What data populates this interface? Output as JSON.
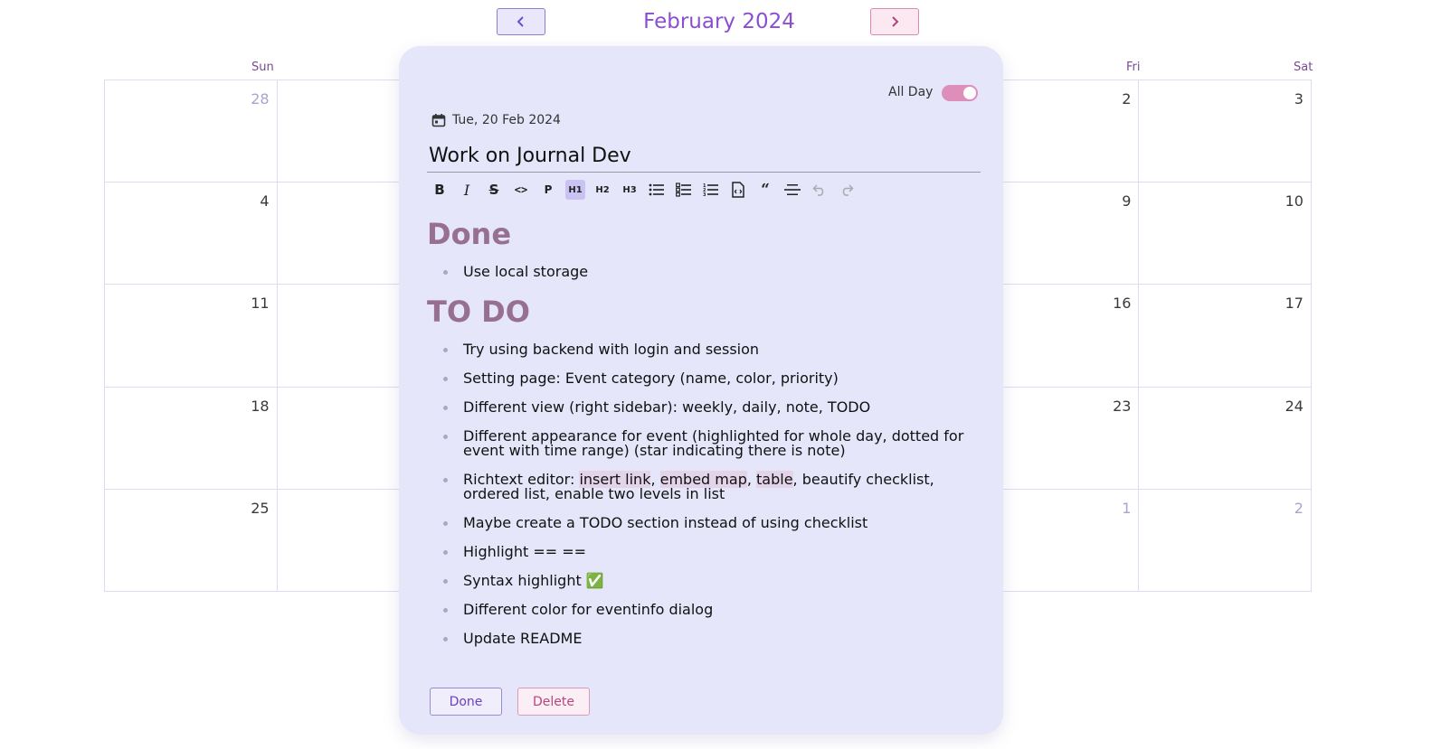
{
  "header": {
    "month_title": "February 2024",
    "prev_icon": "chevron-left-icon",
    "next_icon": "chevron-right-icon"
  },
  "weekdays": [
    "Sun",
    "Fri",
    "Sat"
  ],
  "calendar": {
    "rows": [
      {
        "sun": "28",
        "fri": "2",
        "sat": "3",
        "sun_other": true
      },
      {
        "sun": "4",
        "fri": "9",
        "sat": "10"
      },
      {
        "sun": "11",
        "fri": "16",
        "sat": "17"
      },
      {
        "sun": "18",
        "fri": "23",
        "sat": "24"
      },
      {
        "sun": "25",
        "fri": "1",
        "sat": "2",
        "next_other": true
      }
    ]
  },
  "dialog": {
    "all_day_label": "All Day",
    "all_day_on": true,
    "date": "Tue, 20 Feb 2024",
    "title_value": "Work on Journal Dev",
    "toolbar": [
      "B",
      "I",
      "S",
      "<>",
      "P",
      "H1",
      "H2",
      "H3",
      "bullet-list",
      "checklist",
      "ordered-list",
      "code-block",
      "quote",
      "horizontal-rule",
      "undo",
      "redo"
    ],
    "active_tool": "H1",
    "heading_done": "Done",
    "done_items": [
      "Use local storage"
    ],
    "heading_todo": "TO DO",
    "todo_items": {
      "i0": "Try using backend with login and session",
      "i1": "Setting page: Event category (name, color, priority)",
      "i2": "Different view (right sidebar): weekly, daily, note, TODO",
      "i3": "Different appearance for event (highlighted for whole day, dotted for event with time range) (star indicating there is note)",
      "i4_prefix": "Richtext editor: ",
      "i4_hl1": "insert link",
      "i4_sep1": ", ",
      "i4_hl2": "embed map",
      "i4_sep2": ", ",
      "i4_hl3": "table",
      "i4_rest": ", beautify checklist, ordered list, enable two levels in list",
      "i5": "Maybe create a TODO section instead of using checklist",
      "i6": "Highlight == ==",
      "i7": "Syntax highlight ✅",
      "i8": "Different color for eventinfo dialog",
      "i9": "Update README"
    },
    "done_button": "Done",
    "delete_button": "Delete"
  }
}
